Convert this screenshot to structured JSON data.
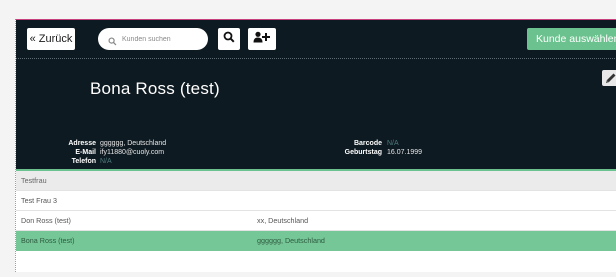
{
  "toolbar": {
    "back_label": "« Zurück",
    "search_placeholder": "Kunden suchen",
    "search_icon": "search-icon",
    "add_user_icon": "add-user-icon",
    "select_label": "Kunde auswählen"
  },
  "customer": {
    "name": "Bona Ross (test)",
    "edit_icon": "pencil-icon",
    "fields_left": [
      {
        "label": "Adresse",
        "value": "gggggg, Deutschland"
      },
      {
        "label": "E-Mail",
        "value": "ify11880@cuoly.com"
      },
      {
        "label": "Telefon",
        "value": "N/A"
      }
    ],
    "fields_right": [
      {
        "label": "Barcode",
        "value": "N/A"
      },
      {
        "label": "Geburtstag",
        "value": "16.07.1999"
      }
    ]
  },
  "results": [
    {
      "name": "Testfrau",
      "address": "",
      "state": "group"
    },
    {
      "name": "Test Frau 3",
      "address": "",
      "state": "normal"
    },
    {
      "name": "Don Ross (test)",
      "address": "xx, Deutschland",
      "state": "normal"
    },
    {
      "name": "Bona Ross (test)",
      "address": "gggggg, Deutschland",
      "state": "selected"
    }
  ],
  "colors": {
    "dark_panel": "#0e1a21",
    "accent_green": "#6cc28e",
    "selected_row": "#76c798",
    "top_border": "#c8417e"
  }
}
